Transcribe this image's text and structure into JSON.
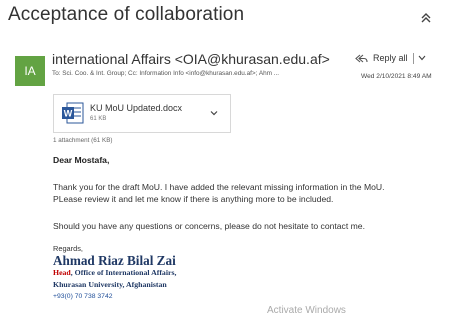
{
  "email": {
    "subject": "Acceptance of collaboration",
    "sender": {
      "initials": "IA",
      "display": "international Affairs <OIA@khurasan.edu.af>",
      "avatar_color": "#63a343"
    },
    "recipients": "To: Sci. Coo. & Int. Group;  Cc: Information Info <info@khurasan.edu.af>; Ahm ...",
    "reply_all_label": "Reply all",
    "date": "Wed 2/10/2021 8:49 AM",
    "attachment": {
      "name": "KU MoU Updated.docx",
      "size": "61 KB",
      "count_label": "1 attachment (61 KB)"
    },
    "body": {
      "greeting": "Dear Mostafa,",
      "p1_line1": "Thank you for the draft MoU. I have added the relevant missing information in the MoU.",
      "p1_line2": "PLease review it and let me know if there is anything more to be included.",
      "p2": "Should you have any questions or concerns, please do not hesitate to contact me."
    },
    "signature": {
      "regards": "Regards,",
      "name": "Ahmad Riaz  Bilal Zai",
      "title_head": "Head",
      "title_rest": ", Office of International Affairs,",
      "university": "Khurasan University, Afghanistan",
      "phone": "+93(0) 70 738 3742"
    }
  },
  "watermark": "Activate Windows",
  "colors": {
    "accent": "#1f3864",
    "signature_red": "#c00000",
    "word_blue": "#2b579a"
  }
}
